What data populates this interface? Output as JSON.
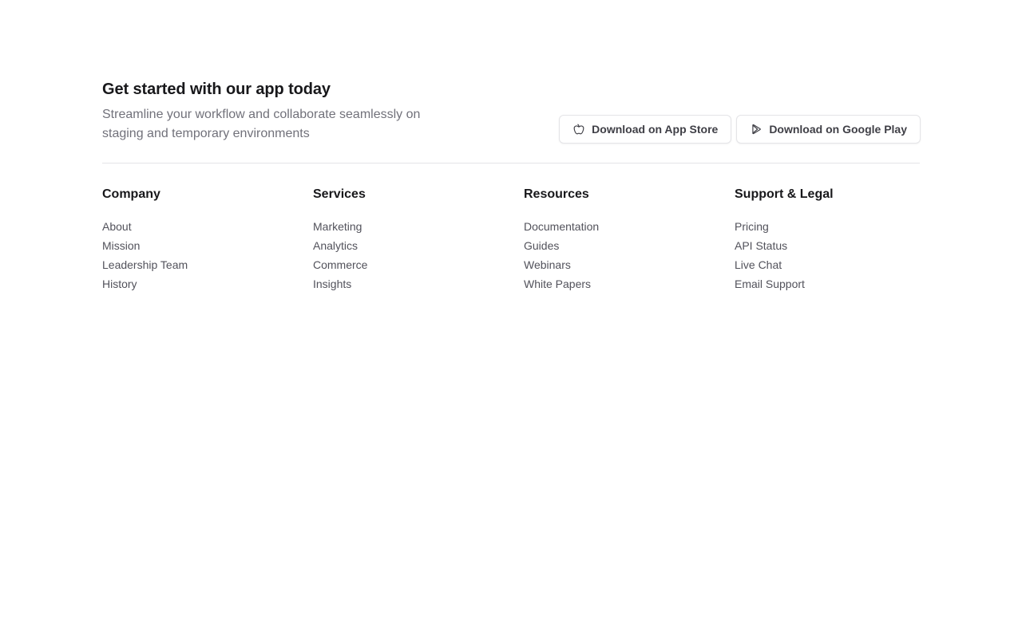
{
  "cta": {
    "title": "Get started with our app today",
    "description": "Streamline your workflow and collaborate seamlessly on staging and temporary environments",
    "buttons": [
      {
        "label": "Download on App Store",
        "icon": "apple-icon"
      },
      {
        "label": "Download on Google Play",
        "icon": "google-play-icon"
      }
    ]
  },
  "columns": [
    {
      "heading": "Company",
      "links": [
        "About",
        "Mission",
        "Leadership Team",
        "History"
      ]
    },
    {
      "heading": "Services",
      "links": [
        "Marketing",
        "Analytics",
        "Commerce",
        "Insights"
      ]
    },
    {
      "heading": "Resources",
      "links": [
        "Documentation",
        "Guides",
        "Webinars",
        "White Papers"
      ]
    },
    {
      "heading": "Support & Legal",
      "links": [
        "Pricing",
        "API Status",
        "Live Chat",
        "Email Support"
      ]
    }
  ],
  "colors": {
    "heading": "#18181b",
    "muted": "#71717a",
    "link": "#52525b",
    "border": "#e4e4e7"
  }
}
